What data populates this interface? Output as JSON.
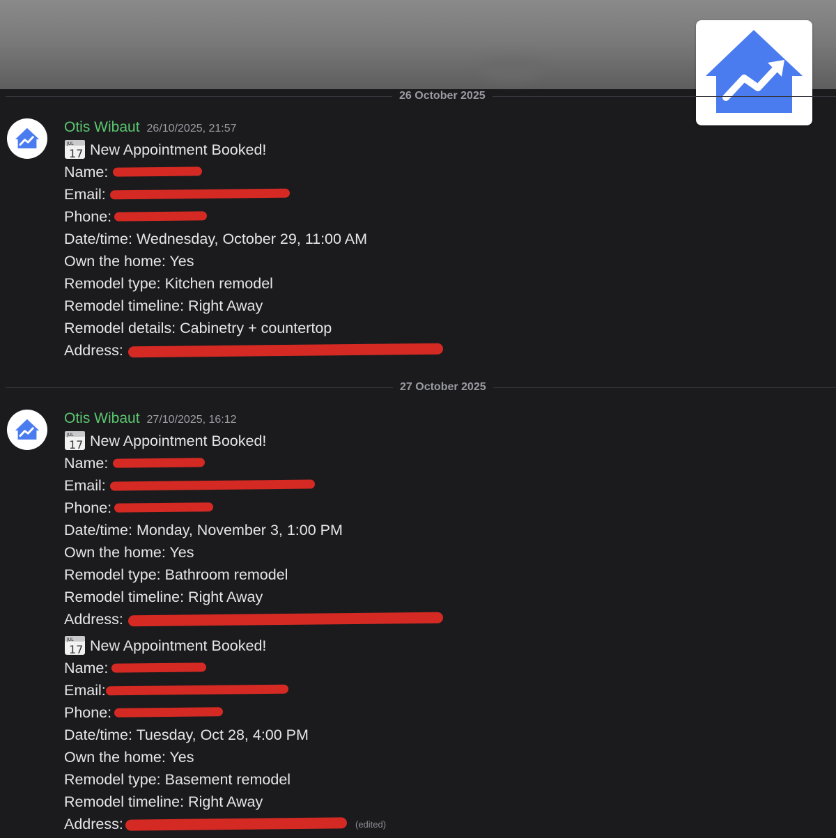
{
  "date_dividers": [
    "26 October 2025",
    "27 October 2025"
  ],
  "messages": [
    {
      "author": "Otis Wibaut",
      "timestamp": "26/10/2025, 21:57",
      "title": "New Appointment Booked!",
      "name_label": "Name:",
      "email_label": "Email:",
      "phone_label": "Phone:",
      "datetime": "Date/time: Wednesday, October 29, 11:00 AM",
      "own_home": "Own the home: Yes",
      "remodel_type": "Remodel type: Kitchen remodel",
      "remodel_timeline": "Remodel timeline: Right Away",
      "remodel_details": "Remodel details: Cabinetry + countertop",
      "address_label": "Address:"
    },
    {
      "author": "Otis Wibaut",
      "timestamp": "27/10/2025, 16:12",
      "title": "New Appointment Booked!",
      "name_label": "Name:",
      "email_label": "Email:",
      "phone_label": "Phone:",
      "datetime": "Date/time: Monday, November 3, 1:00 PM",
      "own_home": "Own the home: Yes",
      "remodel_type": "Remodel type: Bathroom remodel",
      "remodel_timeline": "Remodel timeline: Right Away",
      "address_label": "Address:"
    },
    {
      "title": "New Appointment Booked!",
      "name_label": "Name:",
      "email_label": "Email:",
      "phone_label": "Phone:",
      "datetime": "Date/time: Tuesday, Oct 28, 4:00 PM",
      "own_home": "Own the home: Yes",
      "remodel_type": "Remodel type: Basement remodel",
      "remodel_timeline": "Remodel timeline: Right Away",
      "address_label": "Address:",
      "edited": "(edited)"
    }
  ],
  "calendar_icon": {
    "month": "JUL",
    "day": "17"
  },
  "colors": {
    "accent_logo": "#4a7cf0",
    "author": "#5cc66f",
    "redaction": "#d52a23",
    "background": "#1b1b1e"
  }
}
